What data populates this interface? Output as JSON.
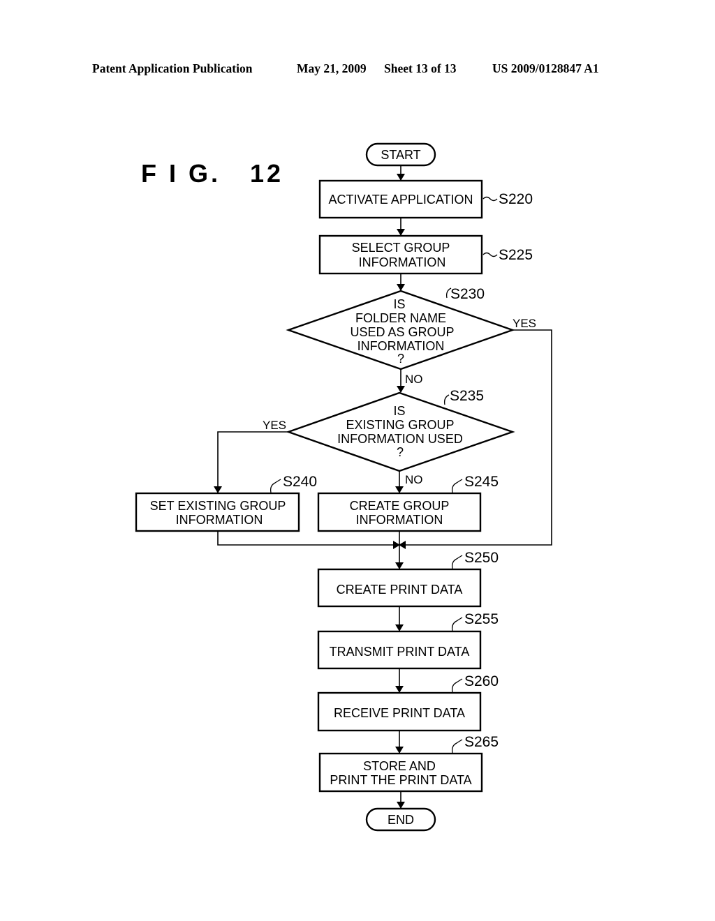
{
  "header": {
    "publication": "Patent Application Publication",
    "date": "May 21, 2009",
    "sheet": "Sheet 13 of 13",
    "number": "US 2009/0128847 A1"
  },
  "figure": {
    "label": "F I G.   12"
  },
  "flowchart": {
    "terminals": {
      "start": "START",
      "end": "END"
    },
    "steps": {
      "s220": {
        "id": "S220",
        "lines": [
          "ACTIVATE APPLICATION"
        ]
      },
      "s225": {
        "id": "S225",
        "lines": [
          "SELECT GROUP",
          "INFORMATION"
        ]
      },
      "s230": {
        "id": "S230",
        "lines": [
          "IS",
          "FOLDER NAME",
          "USED AS GROUP",
          "INFORMATION",
          "?"
        ]
      },
      "s235": {
        "id": "S235",
        "lines": [
          "IS",
          "EXISTING GROUP",
          "INFORMATION USED",
          "?"
        ]
      },
      "s240": {
        "id": "S240",
        "lines": [
          "SET EXISTING GROUP",
          "INFORMATION"
        ]
      },
      "s245": {
        "id": "S245",
        "lines": [
          "CREATE GROUP",
          "INFORMATION"
        ]
      },
      "s250": {
        "id": "S250",
        "lines": [
          "CREATE PRINT DATA"
        ]
      },
      "s255": {
        "id": "S255",
        "lines": [
          "TRANSMIT PRINT DATA"
        ]
      },
      "s260": {
        "id": "S260",
        "lines": [
          "RECEIVE PRINT DATA"
        ]
      },
      "s265": {
        "id": "S265",
        "lines": [
          "STORE AND",
          "PRINT THE PRINT DATA"
        ]
      }
    },
    "branches": {
      "s230_yes": "YES",
      "s230_no": "NO",
      "s235_yes": "YES",
      "s235_no": "NO"
    }
  }
}
